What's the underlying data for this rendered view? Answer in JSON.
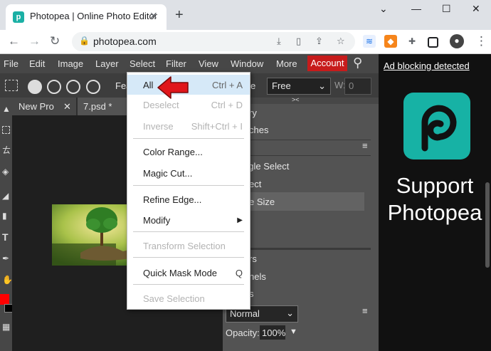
{
  "browser": {
    "tab_title": "Photopea | Online Photo Editor",
    "tab_close": "✕",
    "new_tab": "+",
    "url": "photopea.com",
    "window_controls": [
      "⌄",
      "—",
      "☐",
      "✕"
    ]
  },
  "photopea": {
    "menu": [
      "File",
      "Edit",
      "Image",
      "Layer",
      "Select",
      "Filter",
      "View",
      "Window",
      "More"
    ],
    "account_label": "Account",
    "options_feather_fragment": "Fea",
    "options_e_fragment": "e",
    "selection_mode": "Free",
    "w_label": "W:",
    "w_value": "0",
    "doc_tabs": [
      {
        "label": "New Pro",
        "close": "✕"
      },
      {
        "label": "7.psd *",
        "close": "✕"
      }
    ],
    "right_panel_collapse": "><",
    "right_panel_fragments": [
      "ry",
      "ches",
      "ngle Select",
      "ect",
      "e Size",
      "rs",
      "nels",
      "s"
    ],
    "blend_mode": "Normal",
    "opacity_label": "Opacity:",
    "opacity_value": "100%"
  },
  "select_menu": {
    "items": [
      {
        "label": "All",
        "shortcut": "Ctrl + A",
        "enabled": true
      },
      {
        "label": "Deselect",
        "shortcut": "Ctrl + D",
        "enabled": false
      },
      {
        "label": "Inverse",
        "shortcut": "Shift+Ctrl + I",
        "enabled": false
      },
      {
        "label": "Color Range...",
        "shortcut": "",
        "enabled": true
      },
      {
        "label": "Magic Cut...",
        "shortcut": "",
        "enabled": true
      },
      {
        "label": "Refine Edge...",
        "shortcut": "",
        "enabled": true
      },
      {
        "label": "Modify",
        "shortcut": "▶",
        "enabled": true
      },
      {
        "label": "Transform Selection",
        "shortcut": "",
        "enabled": false
      },
      {
        "label": "Quick Mask Mode",
        "shortcut": "Q",
        "enabled": true
      },
      {
        "label": "Save Selection",
        "shortcut": "",
        "enabled": false
      }
    ]
  },
  "ad": {
    "link_text": "Ad blocking detected",
    "support_line1": "Support",
    "support_line2": "Photopea"
  },
  "colors": {
    "accent_red": "#c71b1b",
    "photopea_teal": "#17b2a5",
    "menu_highlight": "#d6e9f8"
  }
}
